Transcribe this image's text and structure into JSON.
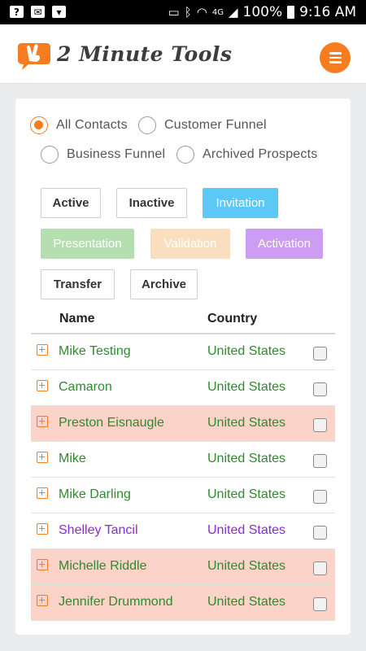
{
  "status_bar": {
    "left_icons": [
      "question-icon",
      "mail-icon",
      "inbox-icon"
    ],
    "right_icons": [
      "cast-icon",
      "bluetooth-icon",
      "wifi-icon",
      "lte-icon",
      "signal-icon"
    ],
    "network": "4G",
    "battery": "100%",
    "time": "9:16 AM"
  },
  "header": {
    "app_name": "2 Minute Tools",
    "logo_icon": "peace-hand-icon",
    "menu_icon": "hamburger-menu-icon",
    "accent_color": "#f57c1f"
  },
  "contact_filter": {
    "selected": "All Contacts",
    "options": [
      "All Contacts",
      "Customer Funnel",
      "Business Funnel",
      "Archived Prospects"
    ]
  },
  "status_chips": [
    {
      "label": "Active",
      "style": "outline"
    },
    {
      "label": "Inactive",
      "style": "outline"
    },
    {
      "label": "Invitation",
      "style": "filled",
      "color": "#5bc8f6"
    },
    {
      "label": "Presentation",
      "style": "filled",
      "color": "#b5dfb0"
    },
    {
      "label": "Validation",
      "style": "filled",
      "color": "#f9dfbf"
    },
    {
      "label": "Activation",
      "style": "filled",
      "color": "#cd9cf3"
    },
    {
      "label": "Transfer",
      "style": "outline"
    },
    {
      "label": "Archive",
      "style": "outline"
    }
  ],
  "table": {
    "columns": [
      "Name",
      "Country"
    ],
    "rows": [
      {
        "name": "Mike Testing",
        "country": "United States",
        "highlight": false,
        "text_color": "#2e8b2e",
        "checked": false
      },
      {
        "name": "Camaron",
        "country": "United States",
        "highlight": false,
        "text_color": "#2e8b2e",
        "checked": false
      },
      {
        "name": "Preston Eisnaugle",
        "country": "United States",
        "highlight": true,
        "text_color": "#2e8b2e",
        "checked": false
      },
      {
        "name": "Mike",
        "country": "United States",
        "highlight": false,
        "text_color": "#2e8b2e",
        "checked": false
      },
      {
        "name": "Mike Darling",
        "country": "United States",
        "highlight": false,
        "text_color": "#2e8b2e",
        "checked": false
      },
      {
        "name": "Shelley Tancil",
        "country": "United States",
        "highlight": false,
        "text_color": "#8a2bd0",
        "checked": false
      },
      {
        "name": "Michelle Riddle",
        "country": "United States",
        "highlight": true,
        "text_color": "#2e8b2e",
        "checked": false
      },
      {
        "name": "Jennifer Drummond",
        "country": "United States",
        "highlight": true,
        "text_color": "#2e8b2e",
        "checked": false
      }
    ]
  }
}
